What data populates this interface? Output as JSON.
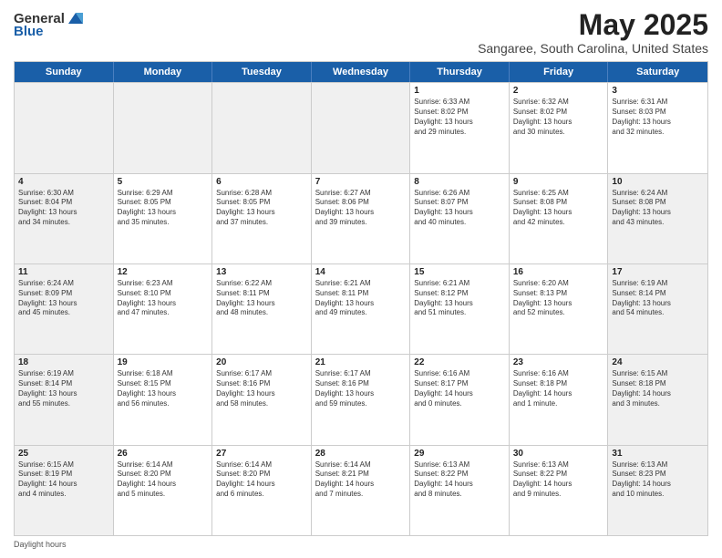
{
  "logo": {
    "text_general": "General",
    "text_blue": "Blue"
  },
  "title": "May 2025",
  "location": "Sangaree, South Carolina, United States",
  "days_of_week": [
    "Sunday",
    "Monday",
    "Tuesday",
    "Wednesday",
    "Thursday",
    "Friday",
    "Saturday"
  ],
  "weeks": [
    [
      {
        "day": "",
        "data": "",
        "shaded": true
      },
      {
        "day": "",
        "data": "",
        "shaded": true
      },
      {
        "day": "",
        "data": "",
        "shaded": true
      },
      {
        "day": "",
        "data": "",
        "shaded": true
      },
      {
        "day": "1",
        "data": "Sunrise: 6:33 AM\nSunset: 8:02 PM\nDaylight: 13 hours\nand 29 minutes.",
        "shaded": false
      },
      {
        "day": "2",
        "data": "Sunrise: 6:32 AM\nSunset: 8:02 PM\nDaylight: 13 hours\nand 30 minutes.",
        "shaded": false
      },
      {
        "day": "3",
        "data": "Sunrise: 6:31 AM\nSunset: 8:03 PM\nDaylight: 13 hours\nand 32 minutes.",
        "shaded": false
      }
    ],
    [
      {
        "day": "4",
        "data": "Sunrise: 6:30 AM\nSunset: 8:04 PM\nDaylight: 13 hours\nand 34 minutes.",
        "shaded": true
      },
      {
        "day": "5",
        "data": "Sunrise: 6:29 AM\nSunset: 8:05 PM\nDaylight: 13 hours\nand 35 minutes.",
        "shaded": false
      },
      {
        "day": "6",
        "data": "Sunrise: 6:28 AM\nSunset: 8:05 PM\nDaylight: 13 hours\nand 37 minutes.",
        "shaded": false
      },
      {
        "day": "7",
        "data": "Sunrise: 6:27 AM\nSunset: 8:06 PM\nDaylight: 13 hours\nand 39 minutes.",
        "shaded": false
      },
      {
        "day": "8",
        "data": "Sunrise: 6:26 AM\nSunset: 8:07 PM\nDaylight: 13 hours\nand 40 minutes.",
        "shaded": false
      },
      {
        "day": "9",
        "data": "Sunrise: 6:25 AM\nSunset: 8:08 PM\nDaylight: 13 hours\nand 42 minutes.",
        "shaded": false
      },
      {
        "day": "10",
        "data": "Sunrise: 6:24 AM\nSunset: 8:08 PM\nDaylight: 13 hours\nand 43 minutes.",
        "shaded": true
      }
    ],
    [
      {
        "day": "11",
        "data": "Sunrise: 6:24 AM\nSunset: 8:09 PM\nDaylight: 13 hours\nand 45 minutes.",
        "shaded": true
      },
      {
        "day": "12",
        "data": "Sunrise: 6:23 AM\nSunset: 8:10 PM\nDaylight: 13 hours\nand 47 minutes.",
        "shaded": false
      },
      {
        "day": "13",
        "data": "Sunrise: 6:22 AM\nSunset: 8:11 PM\nDaylight: 13 hours\nand 48 minutes.",
        "shaded": false
      },
      {
        "day": "14",
        "data": "Sunrise: 6:21 AM\nSunset: 8:11 PM\nDaylight: 13 hours\nand 49 minutes.",
        "shaded": false
      },
      {
        "day": "15",
        "data": "Sunrise: 6:21 AM\nSunset: 8:12 PM\nDaylight: 13 hours\nand 51 minutes.",
        "shaded": false
      },
      {
        "day": "16",
        "data": "Sunrise: 6:20 AM\nSunset: 8:13 PM\nDaylight: 13 hours\nand 52 minutes.",
        "shaded": false
      },
      {
        "day": "17",
        "data": "Sunrise: 6:19 AM\nSunset: 8:14 PM\nDaylight: 13 hours\nand 54 minutes.",
        "shaded": true
      }
    ],
    [
      {
        "day": "18",
        "data": "Sunrise: 6:19 AM\nSunset: 8:14 PM\nDaylight: 13 hours\nand 55 minutes.",
        "shaded": true
      },
      {
        "day": "19",
        "data": "Sunrise: 6:18 AM\nSunset: 8:15 PM\nDaylight: 13 hours\nand 56 minutes.",
        "shaded": false
      },
      {
        "day": "20",
        "data": "Sunrise: 6:17 AM\nSunset: 8:16 PM\nDaylight: 13 hours\nand 58 minutes.",
        "shaded": false
      },
      {
        "day": "21",
        "data": "Sunrise: 6:17 AM\nSunset: 8:16 PM\nDaylight: 13 hours\nand 59 minutes.",
        "shaded": false
      },
      {
        "day": "22",
        "data": "Sunrise: 6:16 AM\nSunset: 8:17 PM\nDaylight: 14 hours\nand 0 minutes.",
        "shaded": false
      },
      {
        "day": "23",
        "data": "Sunrise: 6:16 AM\nSunset: 8:18 PM\nDaylight: 14 hours\nand 1 minute.",
        "shaded": false
      },
      {
        "day": "24",
        "data": "Sunrise: 6:15 AM\nSunset: 8:18 PM\nDaylight: 14 hours\nand 3 minutes.",
        "shaded": true
      }
    ],
    [
      {
        "day": "25",
        "data": "Sunrise: 6:15 AM\nSunset: 8:19 PM\nDaylight: 14 hours\nand 4 minutes.",
        "shaded": true
      },
      {
        "day": "26",
        "data": "Sunrise: 6:14 AM\nSunset: 8:20 PM\nDaylight: 14 hours\nand 5 minutes.",
        "shaded": false
      },
      {
        "day": "27",
        "data": "Sunrise: 6:14 AM\nSunset: 8:20 PM\nDaylight: 14 hours\nand 6 minutes.",
        "shaded": false
      },
      {
        "day": "28",
        "data": "Sunrise: 6:14 AM\nSunset: 8:21 PM\nDaylight: 14 hours\nand 7 minutes.",
        "shaded": false
      },
      {
        "day": "29",
        "data": "Sunrise: 6:13 AM\nSunset: 8:22 PM\nDaylight: 14 hours\nand 8 minutes.",
        "shaded": false
      },
      {
        "day": "30",
        "data": "Sunrise: 6:13 AM\nSunset: 8:22 PM\nDaylight: 14 hours\nand 9 minutes.",
        "shaded": false
      },
      {
        "day": "31",
        "data": "Sunrise: 6:13 AM\nSunset: 8:23 PM\nDaylight: 14 hours\nand 10 minutes.",
        "shaded": true
      }
    ]
  ],
  "footer": {
    "label": "Daylight hours"
  }
}
